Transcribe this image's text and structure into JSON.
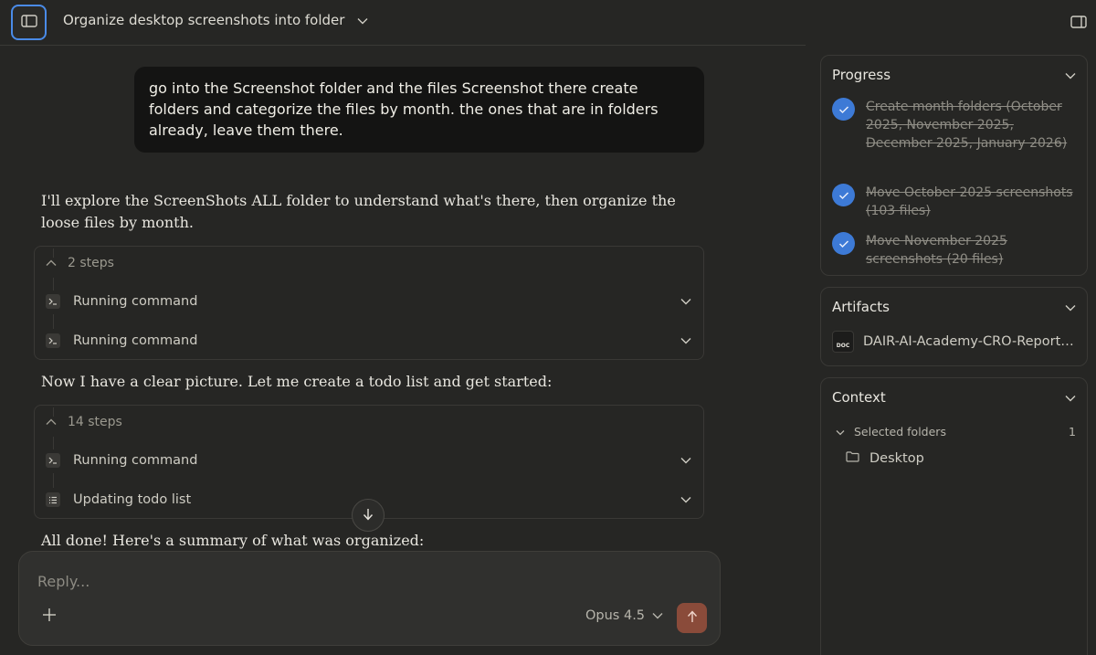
{
  "header": {
    "title": "Organize desktop screenshots into folder"
  },
  "messages": {
    "user_prompt": "go into the Screenshot folder and the files Screenshot there create folders and categorize the files by month. the ones that are in folders already, leave them there.",
    "assistant_1": "I'll explore the ScreenShots ALL folder to understand what's there, then organize the loose files by month.",
    "assistant_2": "Now I have a clear picture. Let me create a todo list and get started:",
    "assistant_3": "All done! Here's a summary of what was organized:"
  },
  "steps_group_1": {
    "count_label": "2 steps",
    "steps": [
      {
        "label": "Running command",
        "icon": "terminal-icon"
      },
      {
        "label": "Running command",
        "icon": "terminal-icon"
      }
    ]
  },
  "steps_group_2": {
    "count_label": "14 steps",
    "steps": [
      {
        "label": "Running command",
        "icon": "terminal-icon"
      },
      {
        "label": "Updating todo list",
        "icon": "checklist-icon"
      }
    ]
  },
  "composer": {
    "placeholder": "Reply...",
    "model": "Opus 4.5"
  },
  "progress": {
    "title": "Progress",
    "items": [
      {
        "text": "Create month folders (October 2025, November 2025, December 2025, January 2026)",
        "done": true
      },
      {
        "text": "Move October 2025 screenshots (103 files)",
        "done": true
      },
      {
        "text": "Move November 2025 screenshots (20 files)",
        "done": true
      }
    ]
  },
  "artifacts": {
    "title": "Artifacts",
    "items": [
      {
        "name": "DAIR-AI-Academy-CRO-Report.docx",
        "badge": "DOC"
      }
    ]
  },
  "context": {
    "title": "Context",
    "group_label": "Selected folders",
    "group_count": "1",
    "folders": [
      {
        "name": "Desktop"
      }
    ]
  },
  "colors": {
    "background": "#262624",
    "accent_blue": "#3d7ad6",
    "send_button": "#8a4b3a"
  }
}
